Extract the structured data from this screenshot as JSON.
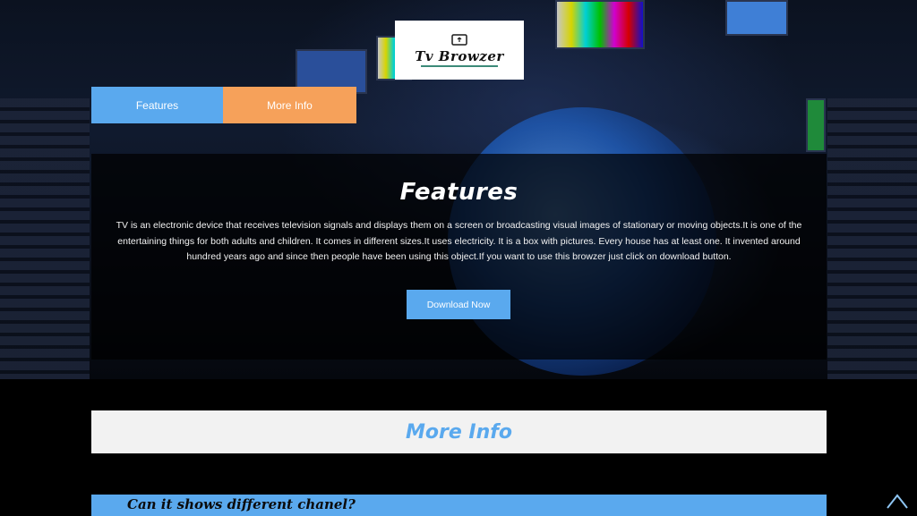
{
  "logo": {
    "text": "Tv Browzer",
    "icon": "tv-cursor-icon"
  },
  "tabs": [
    {
      "label": "Features",
      "color": "#5aa9ee"
    },
    {
      "label": "More Info",
      "color": "#f6a15a"
    }
  ],
  "features": {
    "title": "Features",
    "text": "TV is an electronic device that receives television signals and displays them on a screen or broadcasting visual images of stationary or moving objects.It is one of the entertaining things for both adults and children. It comes in different sizes.It uses electricity. It is a box with pictures. Every house has at least one. It invented around hundred years ago and since then people have been using this object.If you want to use this browzer just click on download button.",
    "download_label": "Download Now"
  },
  "more_info": {
    "title": "More Info"
  },
  "faq": {
    "question": "Can it shows different chanel?"
  },
  "scroll_top": {
    "icon": "chevron-up-icon"
  },
  "colors": {
    "accent_blue": "#5aa9ee",
    "accent_orange": "#f6a15a"
  }
}
